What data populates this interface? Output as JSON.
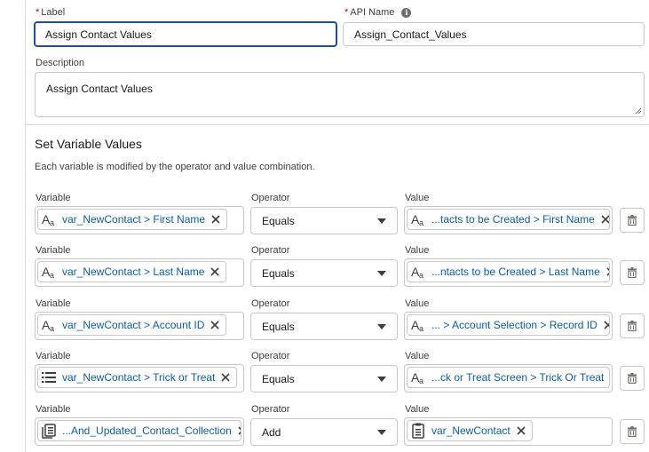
{
  "label_field": {
    "label": "Label",
    "required_mark": "*",
    "value": "Assign Contact Values"
  },
  "api_name_field": {
    "label": "API Name",
    "required_mark": "*",
    "info_icon": "info-icon",
    "value": "Assign_Contact_Values"
  },
  "description_field": {
    "label": "Description",
    "value": "Assign Contact Values"
  },
  "set_variable_values": {
    "title": "Set Variable Values",
    "description": "Each variable is modified by the operator and value combination.",
    "column_labels": {
      "variable": "Variable",
      "operator": "Operator",
      "value": "Value"
    },
    "rows": [
      {
        "variable": "var_NewContact > First Name",
        "variable_icon": "text-icon",
        "operator": "Equals",
        "value": "...tacts to be Created > First Name",
        "value_icon": "text-icon"
      },
      {
        "variable": "var_NewContact > Last Name",
        "variable_icon": "text-icon",
        "operator": "Equals",
        "value": "...ntacts to be Created > Last Name",
        "value_icon": "text-icon"
      },
      {
        "variable": "var_NewContact > Account ID",
        "variable_icon": "text-icon",
        "operator": "Equals",
        "value": "... > Account Selection > Record ID",
        "value_icon": "text-icon"
      },
      {
        "variable": "var_NewContact > Trick or Treat",
        "variable_icon": "picklist-icon",
        "operator": "Equals",
        "value": "...ck or Treat Screen > Trick Or Treat",
        "value_icon": "text-icon"
      },
      {
        "variable": "...And_Updated_Contact_Collection",
        "variable_icon": "collection-icon",
        "operator": "Add",
        "value": "var_NewContact",
        "value_icon": "record-icon"
      }
    ]
  },
  "colors": {
    "focus_border": "#1b5297",
    "pill_text": "#0b5cab",
    "required": "#ba0517",
    "border": "#c9c7c5"
  }
}
